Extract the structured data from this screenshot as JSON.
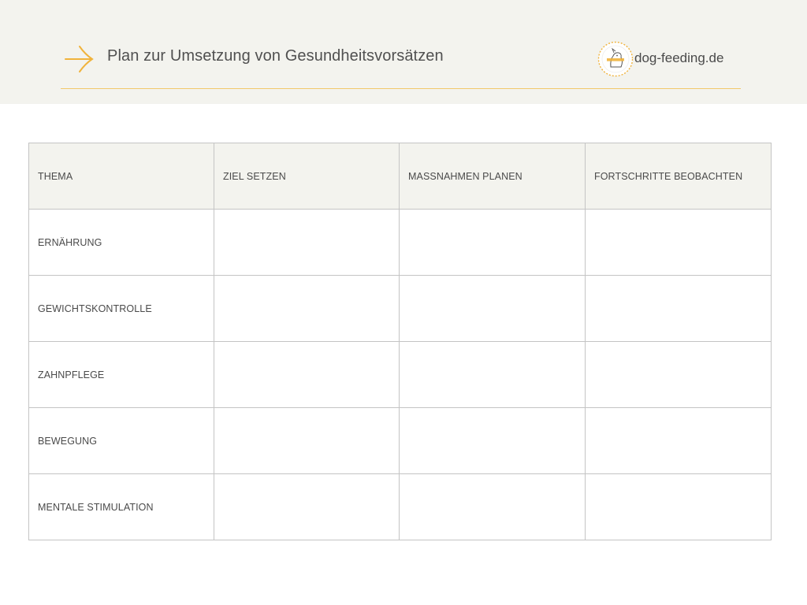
{
  "header": {
    "title": "Plan zur Umsetzung von Gesundheitsvorsätzen",
    "brand": "dog-feeding.de",
    "accent_color": "#f0b33c",
    "background_color": "#f3f3ee",
    "icons": {
      "left": "arrow-right-icon",
      "brand_logo": "dog-feeding-logo"
    }
  },
  "table": {
    "columns": [
      "THEMA",
      "ZIEL SETZEN",
      "MASSNAHMEN PLANEN",
      "FORTSCHRITTE BEOBACHTEN"
    ],
    "rows": [
      {
        "topic": "ERNÄHRUNG",
        "cells": [
          "",
          "",
          ""
        ]
      },
      {
        "topic": "GEWICHTSKONTROLLE",
        "cells": [
          "",
          "",
          ""
        ]
      },
      {
        "topic": "ZAHNPFLEGE",
        "cells": [
          "",
          "",
          ""
        ]
      },
      {
        "topic": "BEWEGUNG",
        "cells": [
          "",
          "",
          ""
        ]
      },
      {
        "topic": "MENTALE STIMULATION",
        "cells": [
          "",
          "",
          ""
        ]
      }
    ]
  }
}
